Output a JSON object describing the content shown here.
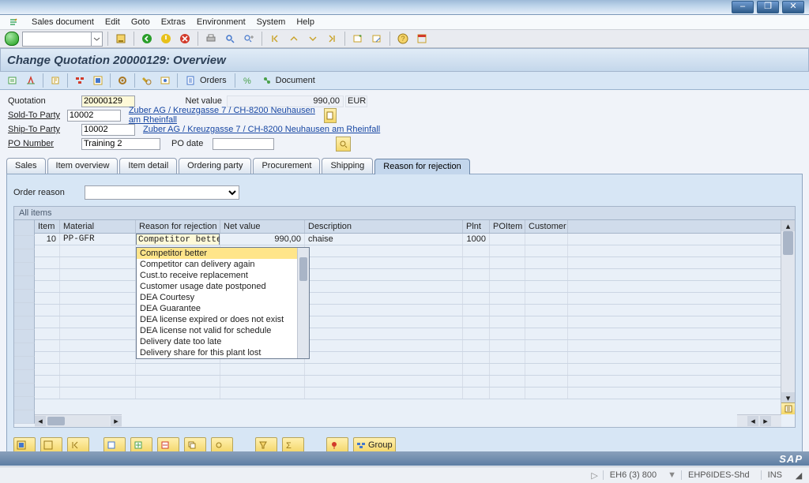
{
  "menu": {
    "items": [
      "Sales document",
      "Edit",
      "Goto",
      "Extras",
      "Environment",
      "System",
      "Help"
    ],
    "underlines": [
      0,
      0,
      0,
      1,
      2,
      1,
      0
    ]
  },
  "window_buttons": {
    "minimize": "–",
    "restore": "❐",
    "close": "✕"
  },
  "page_title": "Change Quotation 20000129: Overview",
  "apptool": {
    "orders": "Orders",
    "document": "Document"
  },
  "form": {
    "quotation": {
      "label": "Quotation",
      "value": "20000129"
    },
    "netvalue": {
      "label": "Net value",
      "value": "990,00",
      "currency": "EUR"
    },
    "soldto": {
      "label": "Sold-To Party",
      "value": "10002",
      "desc": "Zuber AG / Kreuzgasse 7 / CH-8200 Neuhausen am Rheinfall"
    },
    "shipto": {
      "label": "Ship-To Party",
      "value": "10002",
      "desc": "Zuber AG / Kreuzgasse 7 / CH-8200 Neuhausen am Rheinfall"
    },
    "ponum": {
      "label": "PO Number",
      "value": "Training 2"
    },
    "podate": {
      "label": "PO date",
      "value": ""
    }
  },
  "tabs": [
    "Sales",
    "Item overview",
    "Item detail",
    "Ordering party",
    "Procurement",
    "Shipping",
    "Reason for rejection"
  ],
  "active_tab": 6,
  "order_reason": {
    "label": "Order reason",
    "value": ""
  },
  "grid": {
    "title": "All items",
    "headers": [
      "Item",
      "Material",
      "Reason for rejection",
      "Net value",
      "Description",
      "Plnt",
      "POItem",
      "Customer"
    ],
    "rows": [
      {
        "item": "10",
        "material": "PP-GFR",
        "rejection": "Competitor better",
        "netvalue": "990,00",
        "description": "chaise",
        "plnt": "1000",
        "poitem": "",
        "customer": ""
      }
    ],
    "dropdown_options": [
      "Competitor better",
      "Competitor can delivery again",
      "Cust.to receive replacement",
      "Customer usage date postponed",
      "DEA Courtesy",
      "DEA Guarantee",
      "DEA license expired or does not exist",
      "DEA license not valid for schedule",
      "Delivery date too late",
      "Delivery share for this plant lost"
    ]
  },
  "group_btn": "Group",
  "status": {
    "system": "EH6 (3) 800",
    "server": "EHP6IDES-Shd",
    "mode": "INS"
  },
  "colors": {
    "highlight": "#fef9d8",
    "select": "#ffe58a"
  }
}
